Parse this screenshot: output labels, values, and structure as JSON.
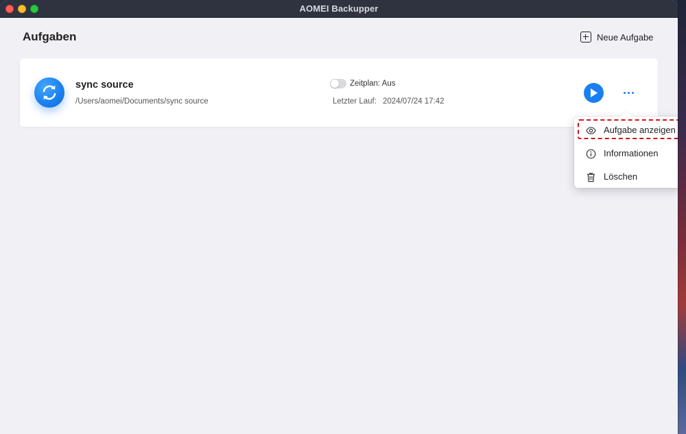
{
  "window": {
    "title": "AOMEI Backupper"
  },
  "page": {
    "title": "Aufgaben",
    "new_task_label": "Neue Aufgabe"
  },
  "task": {
    "name": "sync source",
    "path": "/Users/aomei/Documents/sync source",
    "schedule_label": "Zeitplan: Aus",
    "schedule_enabled": false,
    "last_run_label": "Letzter Lauf:",
    "last_run_value": "2024/07/24 17:42"
  },
  "context_menu": {
    "items": [
      {
        "label": "Aufgabe anzeigen",
        "icon": "eye-icon",
        "highlighted": true
      },
      {
        "label": "Informationen",
        "icon": "info-icon"
      },
      {
        "label": "Löschen",
        "icon": "trash-icon"
      }
    ]
  },
  "colors": {
    "accent": "#1a7ff0",
    "highlight_border": "#d4101a",
    "titlebar": "#2f3340",
    "background": "#f0f0f5"
  }
}
